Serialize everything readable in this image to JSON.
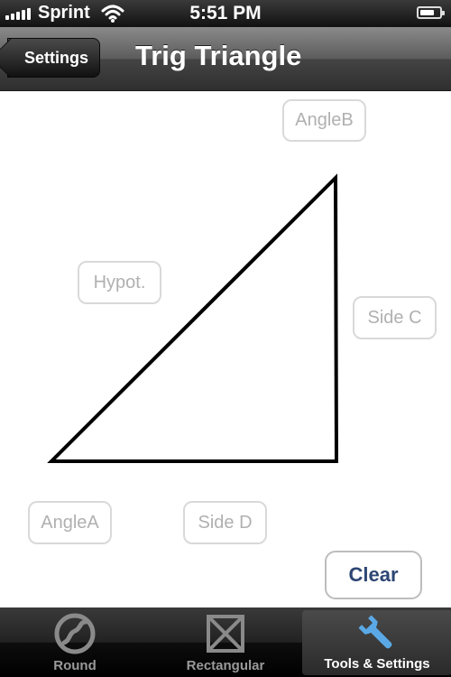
{
  "status_bar": {
    "carrier": "Sprint",
    "time": "5:51 PM",
    "battery_level": 0.75
  },
  "nav": {
    "back_label": "Settings",
    "title": "Trig Triangle"
  },
  "fields": {
    "angle_b": "AngleB",
    "hypotenuse": "Hypot.",
    "side_c": "Side C",
    "angle_a": "AngleA",
    "side_d": "Side D"
  },
  "clear_label": "Clear",
  "tabs": [
    {
      "label": "Round",
      "icon": "round-icon",
      "active": false
    },
    {
      "label": "Rectangular",
      "icon": "rectangular-icon",
      "active": false
    },
    {
      "label": "Tools & Settings",
      "icon": "wrench-icon",
      "active": true
    }
  ]
}
